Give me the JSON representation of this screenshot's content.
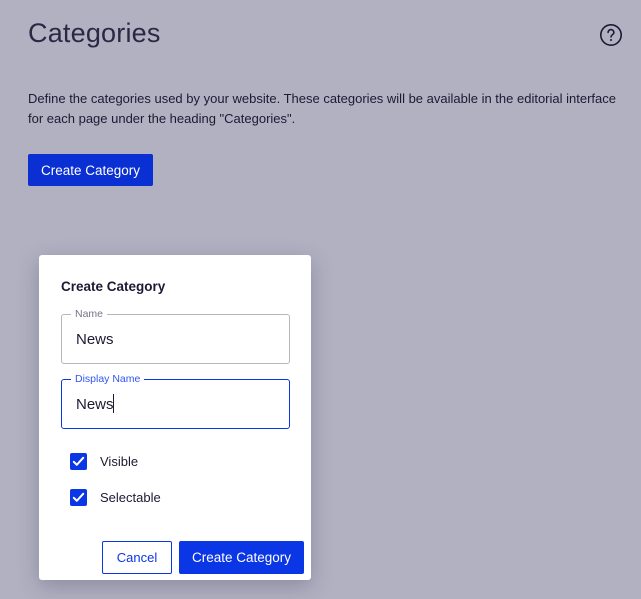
{
  "page": {
    "title": "Categories",
    "description": "Define the categories used by your website. These categories will be available in the editorial interface for each page under the heading \"Categories\".",
    "create_button_label": "Create Category",
    "help_icon": "help-circle-icon"
  },
  "modal": {
    "title": "Create Category",
    "name_field": {
      "label": "Name",
      "value": "News"
    },
    "display_name_field": {
      "label": "Display Name",
      "value": "News"
    },
    "checkboxes": [
      {
        "label": "Visible",
        "checked": true
      },
      {
        "label": "Selectable",
        "checked": true
      }
    ],
    "cancel_label": "Cancel",
    "submit_label": "Create Category"
  },
  "colors": {
    "overlay_background": "#b2b1c2",
    "primary": "#0a36e6",
    "text": "#1b1a33"
  }
}
